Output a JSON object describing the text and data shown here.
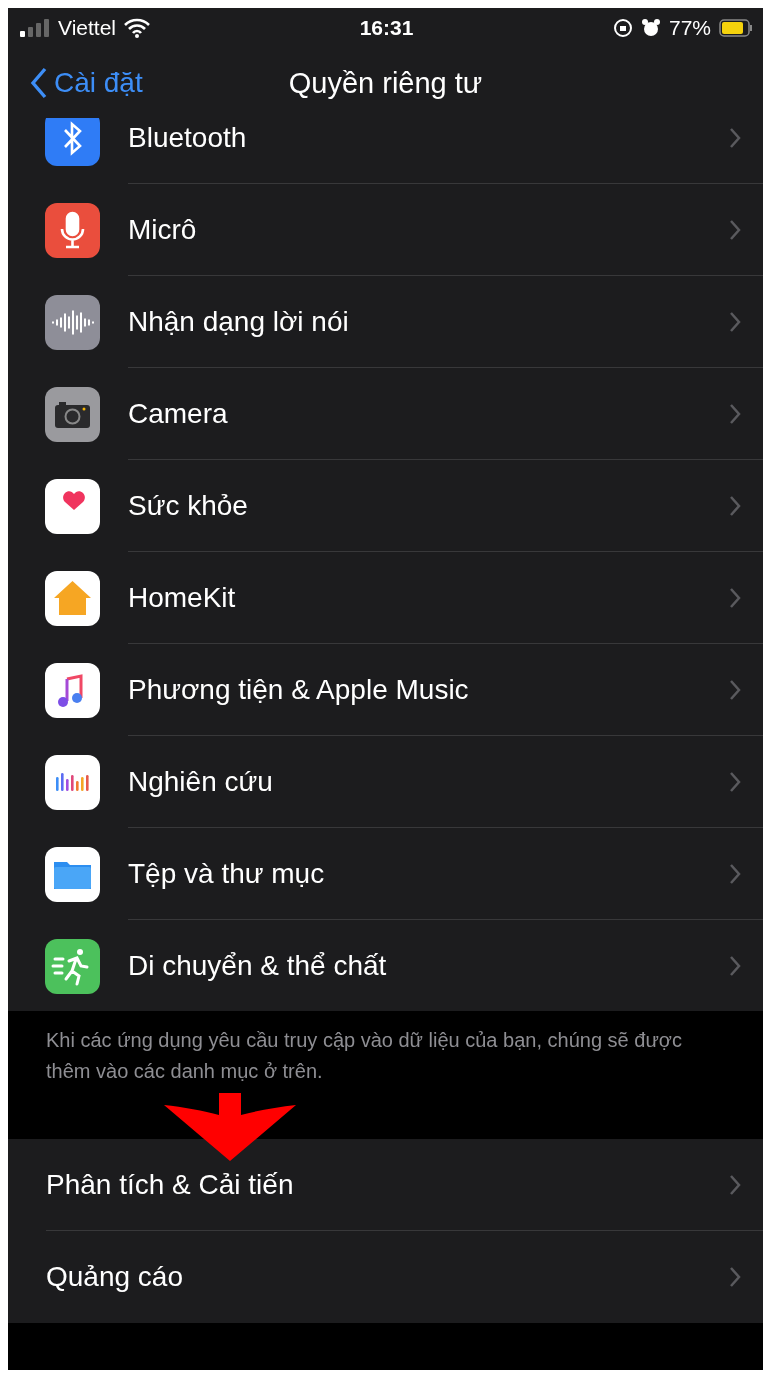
{
  "status_bar": {
    "carrier": "Viettel",
    "time": "16:31",
    "battery": "77%"
  },
  "nav": {
    "back": "Cài đặt",
    "title": "Quyền riêng tư"
  },
  "privacy_items": [
    {
      "label": "Bluetooth",
      "kind": "bluetooth"
    },
    {
      "label": "Micrô",
      "kind": "mic"
    },
    {
      "label": "Nhận dạng lời nói",
      "kind": "speech"
    },
    {
      "label": "Camera",
      "kind": "camera"
    },
    {
      "label": "Sức khỏe",
      "kind": "health"
    },
    {
      "label": "HomeKit",
      "kind": "home"
    },
    {
      "label": "Phương tiện & Apple Music",
      "kind": "music"
    },
    {
      "label": "Nghiên cứu",
      "kind": "research"
    },
    {
      "label": "Tệp và thư mục",
      "kind": "files"
    },
    {
      "label": "Di chuyển & thể chất",
      "kind": "fitness"
    }
  ],
  "footer_note": "Khi các ứng dụng yêu cầu truy cập vào dữ liệu của bạn, chúng sẽ được thêm vào các danh mục ở trên.",
  "other_items": [
    {
      "label": "Phân tích & Cải tiến"
    },
    {
      "label": "Quảng cáo"
    }
  ]
}
